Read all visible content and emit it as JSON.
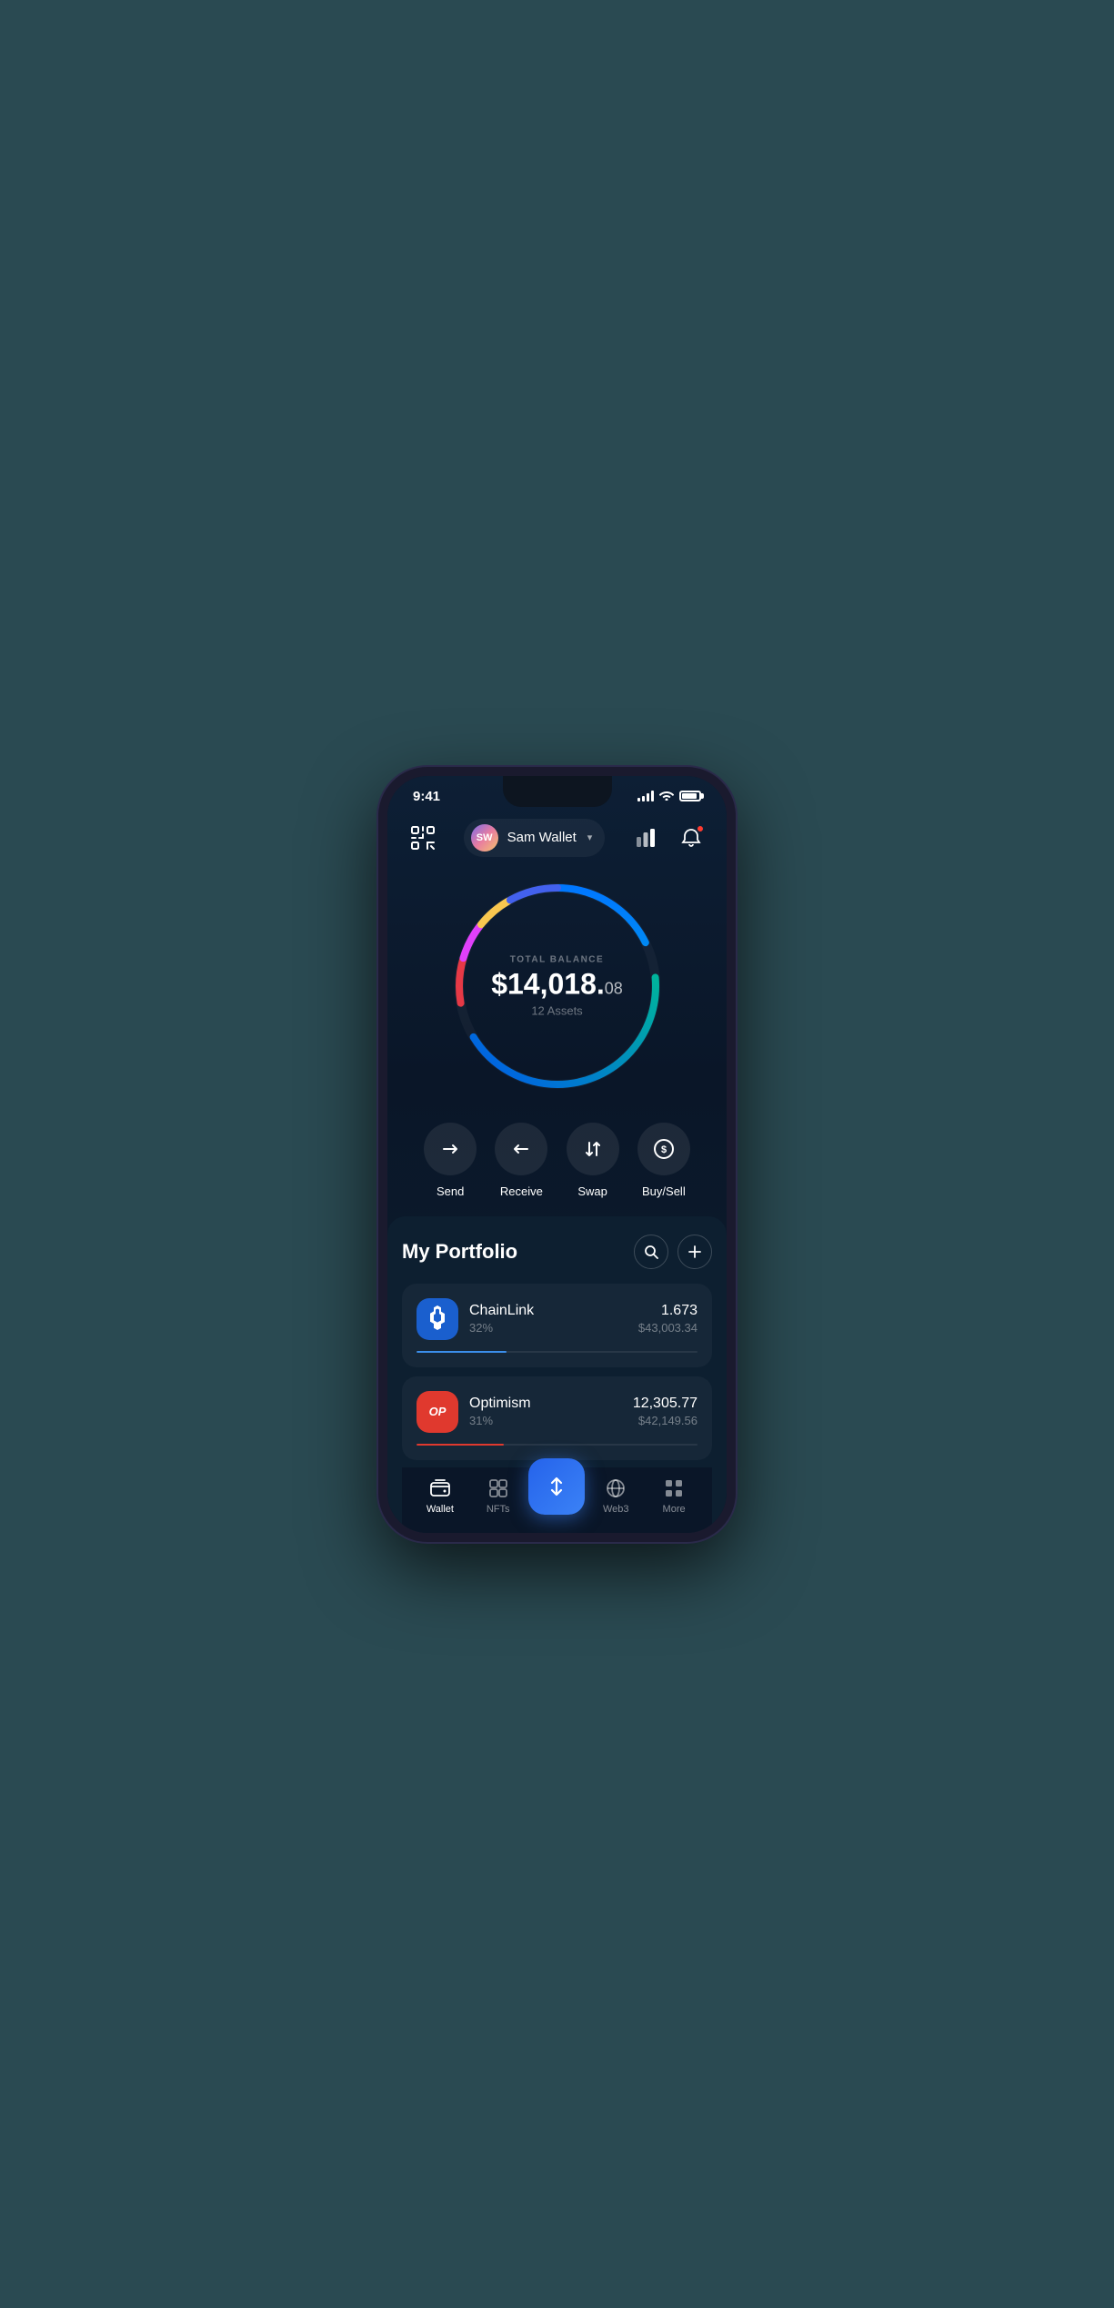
{
  "statusBar": {
    "time": "9:41"
  },
  "header": {
    "scanLabel": "scan",
    "accountName": "Sam Wallet",
    "accountInitials": "SW",
    "chartLabel": "chart",
    "notificationLabel": "notification"
  },
  "balance": {
    "label": "TOTAL BALANCE",
    "whole": "$14,018.",
    "cents": "08",
    "assets": "12 Assets"
  },
  "actions": [
    {
      "id": "send",
      "label": "Send",
      "icon": "→"
    },
    {
      "id": "receive",
      "label": "Receive",
      "icon": "←"
    },
    {
      "id": "swap",
      "label": "Swap",
      "icon": "⇅"
    },
    {
      "id": "buysell",
      "label": "Buy/Sell",
      "icon": "$"
    }
  ],
  "portfolio": {
    "title": "My Portfolio",
    "searchLabel": "search",
    "addLabel": "add"
  },
  "assets": [
    {
      "id": "chainlink",
      "name": "ChainLink",
      "pct": "32%",
      "amount": "1.673",
      "usd": "$43,003.34",
      "progress": 32
    },
    {
      "id": "optimism",
      "name": "Optimism",
      "pct": "31%",
      "amount": "12,305.77",
      "usd": "$42,149.56",
      "progress": 31
    }
  ],
  "bottomNav": [
    {
      "id": "wallet",
      "label": "Wallet",
      "active": true
    },
    {
      "id": "nfts",
      "label": "NFTs",
      "active": false
    },
    {
      "id": "center",
      "label": "",
      "active": false
    },
    {
      "id": "web3",
      "label": "Web3",
      "active": false
    },
    {
      "id": "more",
      "label": "More",
      "active": false
    }
  ]
}
